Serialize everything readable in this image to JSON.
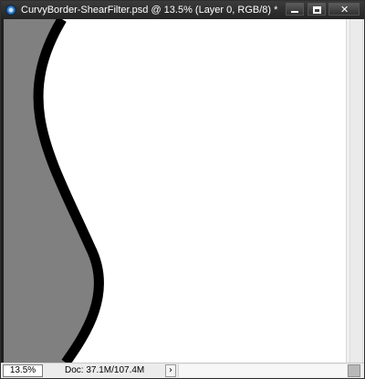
{
  "window": {
    "title": "CurvyBorder-ShearFilter.psd @ 13.5% (Layer 0, RGB/8) *",
    "app_icon": "photoshop-document-icon",
    "controls": {
      "minimize_icon": "minimize-icon",
      "maximize_icon": "maximize-icon",
      "close_icon": "close-icon",
      "close_glyph": "✕"
    }
  },
  "canvas": {
    "background": "#ffffff",
    "fill_color": "#808080",
    "stroke_color": "#000000"
  },
  "statusbar": {
    "zoom": "13.5%",
    "doc_info": "Doc: 37.1M/107.4M",
    "arrow_glyph": "›"
  }
}
